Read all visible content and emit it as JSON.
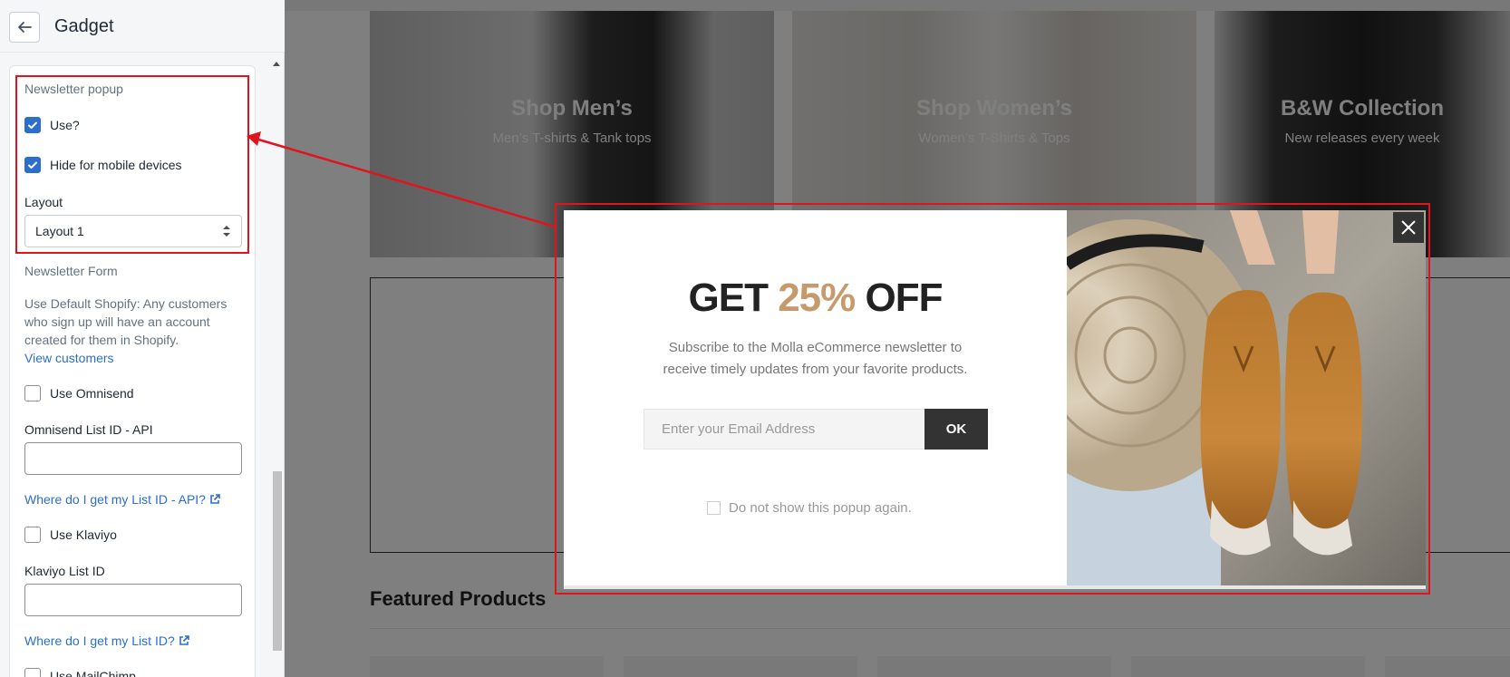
{
  "editor": {
    "title": "Gadget",
    "back_label": "Back",
    "newsletter_popup": {
      "heading": "Newsletter popup",
      "use_label": "Use?",
      "use_checked": true,
      "hide_mobile_label": "Hide for mobile devices",
      "hide_mobile_checked": true,
      "layout_label": "Layout",
      "layout_value": "Layout 1"
    },
    "newsletter_form": {
      "heading": "Newsletter Form",
      "help_text": "Use Default Shopify: Any customers who sign up will have an account created for them in Shopify.",
      "view_customers_link": "View customers",
      "omnisend_label": "Use Omnisend",
      "omnisend_list_label": "Omnisend List ID - API",
      "omnisend_help_link": "Where do I get my List ID - API?",
      "klaviyo_label": "Use Klaviyo",
      "klaviyo_list_label": "Klaviyo List ID",
      "klaviyo_help_link": "Where do I get my List ID?",
      "mailchimp_label": "Use MailChimp"
    }
  },
  "preview": {
    "banners": [
      {
        "title": "Shop Men’s",
        "subtitle": "Men’s T-shirts & Tank tops"
      },
      {
        "title": "Shop Women’s",
        "subtitle": "Women’s T-Shirts & Tops"
      },
      {
        "title": "B&W Collection",
        "subtitle": "New releases every week"
      }
    ],
    "featured_title": "Featured Products",
    "popup": {
      "heading_pre": "GET ",
      "heading_accent": "25%",
      "heading_post": " OFF",
      "text_line1": "Subscribe to the Molla eCommerce newsletter to",
      "text_line2": "receive timely updates from your favorite products.",
      "email_placeholder": "Enter your Email Address",
      "ok_label": "OK",
      "dont_show_label": "Do not show this popup again."
    }
  },
  "colors": {
    "accent": "#c79a6d",
    "highlight": "#e0141e",
    "link": "#2c6ecb",
    "checkbox": "#2c6ecb"
  }
}
